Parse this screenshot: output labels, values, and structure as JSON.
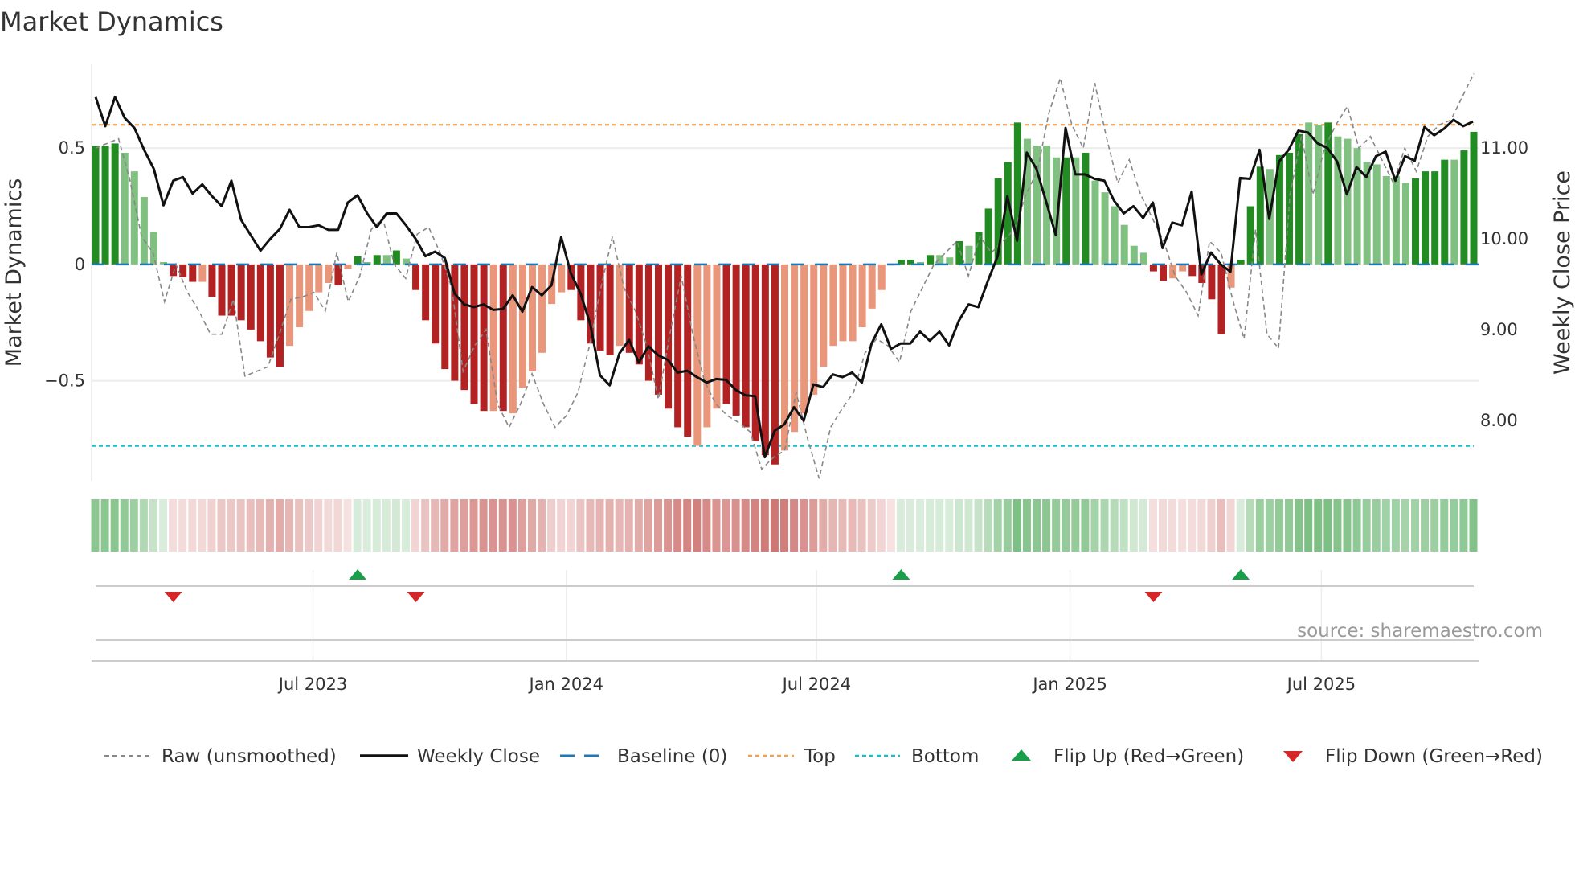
{
  "title": "Market Dynamics",
  "source": "source: sharemaestro.com",
  "colors": {
    "pos_strong": "#228b22",
    "pos_weak": "#80c080",
    "neg_strong": "#b22222",
    "neg_weak": "#e9967a",
    "close": "#111111",
    "raw": "#888888",
    "baseline": "#1f77b4",
    "top": "#f0a050",
    "bottom": "#17becf",
    "flip_up": "#1a9e4a",
    "flip_down": "#d62728"
  },
  "chart_data": {
    "type": "bar",
    "title": "Market Dynamics",
    "ylabel": "Market Dynamics",
    "y2label": "Weekly Close Price",
    "ylim": [
      -0.93,
      0.86
    ],
    "y2lim": [
      7.33,
      11.91
    ],
    "yticks": [
      {
        "v": 0.5,
        "label": "0.5"
      },
      {
        "v": 0,
        "label": "0"
      },
      {
        "v": -0.5,
        "label": "−0.5"
      }
    ],
    "y2ticks": [
      {
        "v": 11,
        "label": "11.00"
      },
      {
        "v": 10,
        "label": "10.00"
      },
      {
        "v": 9,
        "label": "9.00"
      },
      {
        "v": 8,
        "label": "8.00"
      }
    ],
    "xticks": [
      {
        "week": 22.4,
        "label": "Jul 2023"
      },
      {
        "week": 48.5,
        "label": "Jan 2024"
      },
      {
        "week": 74.3,
        "label": "Jul 2024"
      },
      {
        "week": 100.4,
        "label": "Jan 2025"
      },
      {
        "week": 126.3,
        "label": "Jul 2025"
      }
    ],
    "top": 0.6,
    "bottom": -0.78,
    "baseline": 0,
    "momentum": [
      0.51,
      0.51,
      0.52,
      0.48,
      0.4,
      0.29,
      0.14,
      0.01,
      -0.05,
      -0.055,
      -0.075,
      -0.075,
      -0.14,
      -0.22,
      -0.22,
      -0.24,
      -0.28,
      -0.33,
      -0.4,
      -0.44,
      -0.35,
      -0.27,
      -0.2,
      -0.12,
      -0.08,
      -0.09,
      -0.02,
      0.035,
      0.01,
      0.04,
      0.04,
      0.06,
      0.025,
      -0.11,
      -0.24,
      -0.34,
      -0.45,
      -0.5,
      -0.54,
      -0.6,
      -0.63,
      -0.63,
      -0.63,
      -0.64,
      -0.53,
      -0.46,
      -0.38,
      -0.17,
      -0.12,
      -0.11,
      -0.24,
      -0.34,
      -0.37,
      -0.39,
      -0.35,
      -0.38,
      -0.43,
      -0.5,
      -0.56,
      -0.62,
      -0.7,
      -0.74,
      -0.78,
      -0.7,
      -0.62,
      -0.6,
      -0.65,
      -0.7,
      -0.76,
      -0.82,
      -0.86,
      -0.8,
      -0.72,
      -0.64,
      -0.56,
      -0.44,
      -0.35,
      -0.33,
      -0.33,
      -0.27,
      -0.19,
      -0.11,
      -0.005,
      0.02,
      0.02,
      0.01,
      0.04,
      0.04,
      0.03,
      0.1,
      0.08,
      0.14,
      0.24,
      0.37,
      0.44,
      0.61,
      0.54,
      0.51,
      0.51,
      0.46,
      0.46,
      0.46,
      0.48,
      0.36,
      0.31,
      0.25,
      0.17,
      0.08,
      0.05,
      -0.03,
      -0.07,
      -0.06,
      -0.03,
      -0.05,
      -0.08,
      -0.15,
      -0.3,
      -0.1,
      0.02,
      0.25,
      0.42,
      0.41,
      0.47,
      0.48,
      0.56,
      0.61,
      0.6,
      0.61,
      0.55,
      0.54,
      0.5,
      0.44,
      0.43,
      0.38,
      0.38,
      0.35,
      0.37,
      0.4,
      0.4,
      0.45,
      0.45,
      0.49,
      0.57
    ],
    "strong": [
      1,
      1,
      1,
      0,
      0,
      0,
      0,
      0,
      1,
      1,
      1,
      0,
      1,
      1,
      1,
      1,
      1,
      1,
      1,
      1,
      0,
      0,
      0,
      0,
      0,
      1,
      0,
      1,
      0,
      1,
      0,
      1,
      0,
      1,
      1,
      1,
      1,
      1,
      1,
      1,
      1,
      0,
      1,
      0,
      0,
      0,
      0,
      0,
      0,
      1,
      1,
      1,
      1,
      1,
      0,
      1,
      1,
      1,
      1,
      1,
      1,
      1,
      0,
      0,
      0,
      1,
      1,
      1,
      1,
      1,
      1,
      0,
      0,
      0,
      0,
      0,
      0,
      0,
      0,
      0,
      0,
      0,
      0,
      1,
      1,
      0,
      1,
      0,
      0,
      1,
      0,
      1,
      1,
      1,
      1,
      1,
      0,
      0,
      0,
      0,
      1,
      0,
      1,
      0,
      0,
      0,
      0,
      0,
      0,
      1,
      1,
      0,
      0,
      1,
      1,
      1,
      1,
      0,
      1,
      1,
      1,
      0,
      1,
      1,
      1,
      0,
      0,
      1,
      0,
      0,
      0,
      0,
      0,
      0,
      0,
      0,
      1,
      1,
      1,
      1,
      0,
      1,
      1
    ],
    "close": [
      11.55,
      11.23,
      11.55,
      11.32,
      11.21,
      10.97,
      10.76,
      10.36,
      10.63,
      10.67,
      10.49,
      10.59,
      10.46,
      10.35,
      10.63,
      10.2,
      10.03,
      9.86,
      9.99,
      10.1,
      10.31,
      10.12,
      10.12,
      10.14,
      10.09,
      10.09,
      10.39,
      10.47,
      10.27,
      10.12,
      10.27,
      10.27,
      10.14,
      9.99,
      9.8,
      9.85,
      9.78,
      9.39,
      9.27,
      9.24,
      9.27,
      9.21,
      9.22,
      9.37,
      9.19,
      9.46,
      9.37,
      9.48,
      10.01,
      9.61,
      9.39,
      9.05,
      8.49,
      8.38,
      8.73,
      8.88,
      8.63,
      8.81,
      8.71,
      8.66,
      8.52,
      8.54,
      8.47,
      8.41,
      8.45,
      8.44,
      8.33,
      8.27,
      8.26,
      7.59,
      7.88,
      7.95,
      8.14,
      7.99,
      8.39,
      8.36,
      8.5,
      8.47,
      8.52,
      8.41,
      8.84,
      9.05,
      8.78,
      8.84,
      8.84,
      8.97,
      8.87,
      8.97,
      8.82,
      9.09,
      9.27,
      9.24,
      9.53,
      9.8,
      10.46,
      9.97,
      10.94,
      10.76,
      10.4,
      10.03,
      11.21,
      10.7,
      10.7,
      10.65,
      10.63,
      10.41,
      10.27,
      10.35,
      10.22,
      10.39,
      9.89,
      10.17,
      10.14,
      10.51,
      9.6,
      9.84,
      9.71,
      9.63,
      10.66,
      10.65,
      10.97,
      10.21,
      10.84,
      10.97,
      11.18,
      11.16,
      11.04,
      10.99,
      10.84,
      10.48,
      10.78,
      10.67,
      10.9,
      10.95,
      10.63,
      10.9,
      10.85,
      11.22,
      11.13,
      11.2,
      11.3,
      11.23,
      11.28
    ],
    "raw": [
      0.5,
      0.52,
      0.54,
      0.36,
      0.12,
      0.05,
      -0.16,
      0.0,
      -0.12,
      -0.2,
      -0.3,
      -0.3,
      -0.15,
      -0.48,
      -0.46,
      -0.44,
      -0.3,
      -0.15,
      -0.14,
      -0.12,
      -0.2,
      0.05,
      -0.16,
      -0.05,
      0.15,
      0.2,
      0.0,
      -0.06,
      0.13,
      0.16,
      0.05,
      -0.1,
      -0.46,
      -0.35,
      -0.28,
      -0.6,
      -0.7,
      -0.6,
      -0.47,
      -0.6,
      -0.7,
      -0.65,
      -0.55,
      -0.35,
      -0.1,
      0.12,
      -0.1,
      -0.2,
      -0.35,
      -0.58,
      -0.3,
      -0.05,
      -0.3,
      -0.5,
      -0.6,
      -0.65,
      -0.68,
      -0.72,
      -0.88,
      -0.83,
      -0.8,
      -0.55,
      -0.75,
      -0.92,
      -0.7,
      -0.62,
      -0.55,
      -0.38,
      -0.32,
      -0.35,
      -0.42,
      -0.2,
      -0.1,
      0.0,
      0.05,
      0.1,
      -0.05,
      0.12,
      0.05,
      0.1,
      0.15,
      0.3,
      0.4,
      0.65,
      0.8,
      0.6,
      0.5,
      0.78,
      0.55,
      0.35,
      0.45,
      0.3,
      0.2,
      0.1,
      -0.05,
      -0.12,
      -0.22,
      0.1,
      0.05,
      -0.15,
      -0.32,
      0.15,
      -0.3,
      -0.36,
      0.3,
      0.55,
      0.3,
      0.5,
      0.6,
      0.68,
      0.5,
      0.55,
      0.45,
      0.35,
      0.5,
      0.4,
      0.55,
      0.6,
      0.62,
      0.72,
      0.82
    ],
    "flips_up": [
      27,
      83,
      118
    ],
    "flips_down": [
      8,
      33,
      109
    ],
    "legend": {
      "raw": "Raw (unsmoothed)",
      "close": "Weekly Close",
      "baseline": "Baseline (0)",
      "top": "Top",
      "bottom": "Bottom",
      "flip_up": "Flip Up (Red→Green)",
      "flip_down": "Flip Down (Green→Red)"
    }
  }
}
